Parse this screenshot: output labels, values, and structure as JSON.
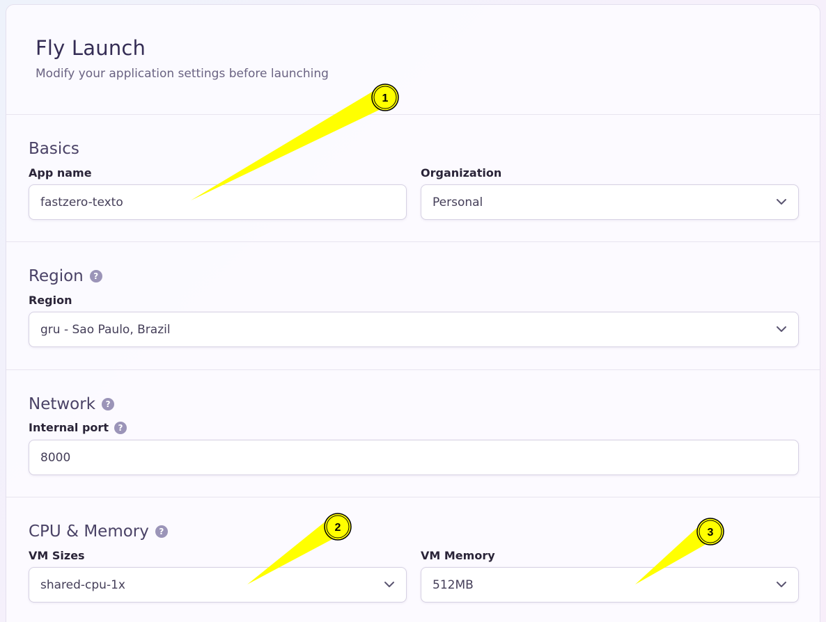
{
  "header": {
    "title": "Fly Launch",
    "subtitle": "Modify your application settings before launching"
  },
  "basics": {
    "title": "Basics",
    "app_name_label": "App name",
    "app_name_value": "fastzero-texto",
    "organization_label": "Organization",
    "organization_value": "Personal"
  },
  "region": {
    "title": "Region",
    "region_label": "Region",
    "region_value": "gru - Sao Paulo, Brazil"
  },
  "network": {
    "title": "Network",
    "port_label": "Internal port",
    "port_value": "8000"
  },
  "cpu_memory": {
    "title": "CPU & Memory",
    "vm_sizes_label": "VM Sizes",
    "vm_sizes_value": "shared-cpu-1x",
    "vm_memory_label": "VM Memory",
    "vm_memory_value": "512MB"
  },
  "help_icon_glyph": "?",
  "annotations": [
    {
      "number": "1"
    },
    {
      "number": "2"
    },
    {
      "number": "3"
    }
  ],
  "colors": {
    "accent_text": "#352d55",
    "callout_fill": "#ffff00",
    "help_icon": "#9b94b8"
  },
  "icons": {
    "chevron": "chevron-down-icon",
    "help": "question-circle-icon"
  }
}
